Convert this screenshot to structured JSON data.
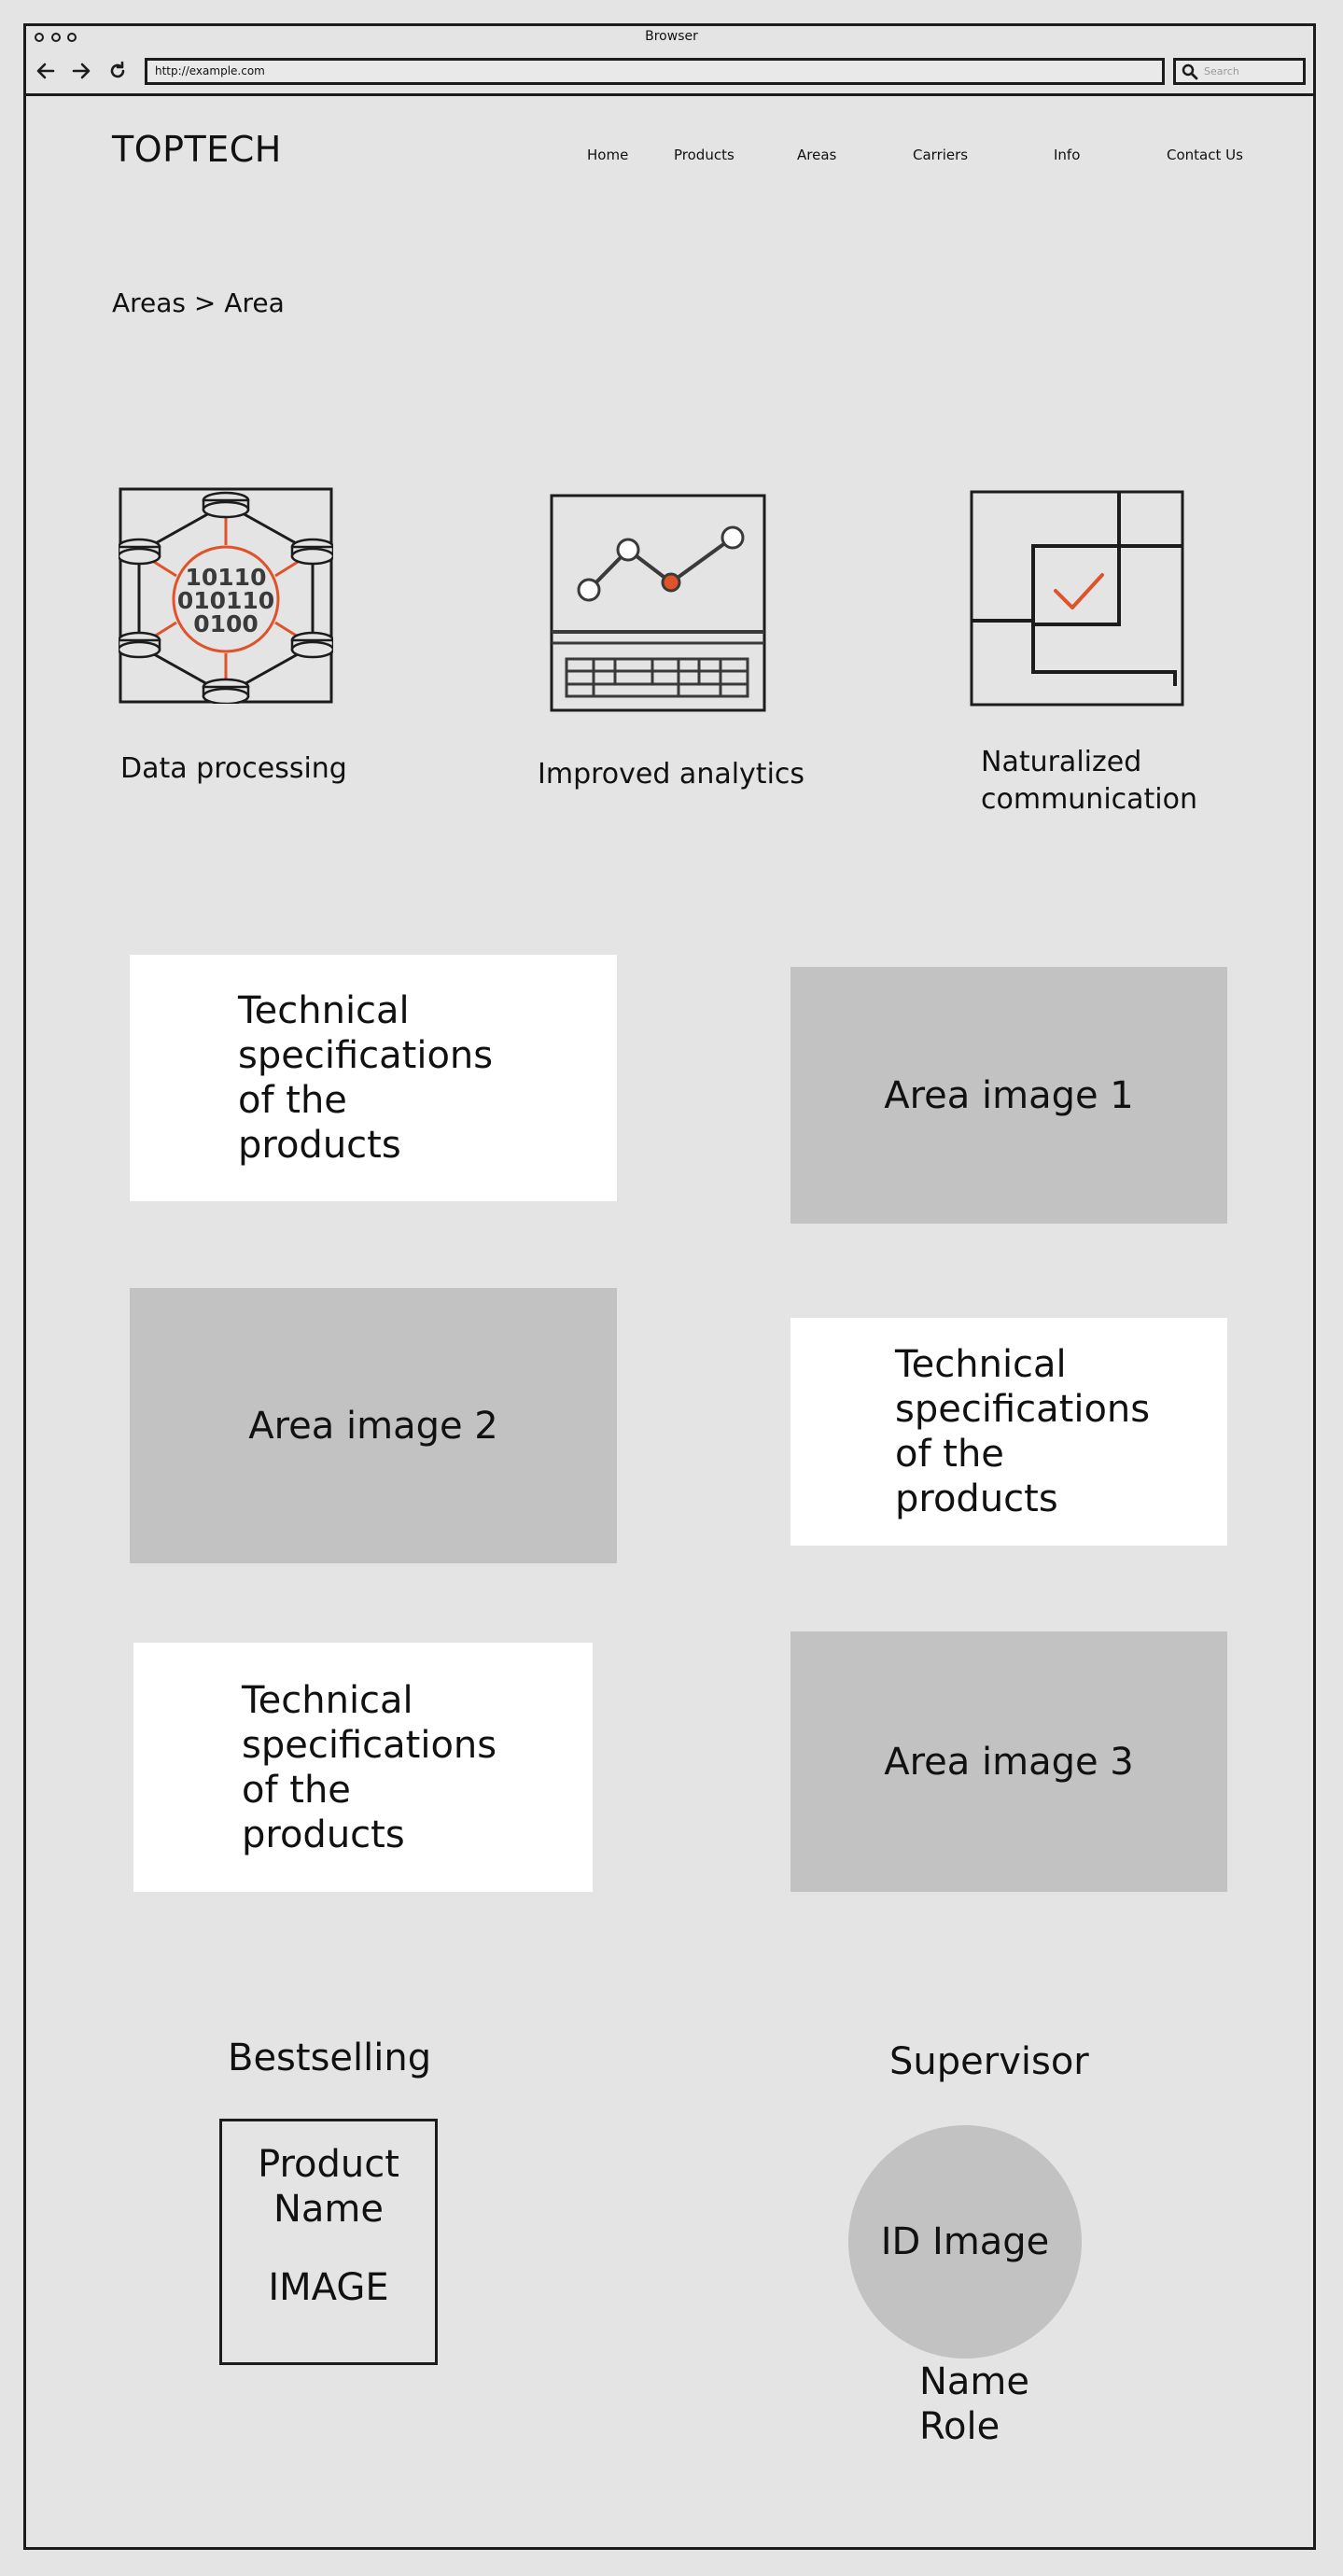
{
  "browser": {
    "title": "Browser",
    "url": "http://example.com",
    "search_placeholder": "Search"
  },
  "header": {
    "logo": "TOPTECH",
    "nav": [
      "Home",
      "Products",
      "Areas",
      "Carriers",
      "Info",
      "Contact Us"
    ]
  },
  "breadcrumb": "Areas > Area",
  "features": [
    {
      "label": "Data processing",
      "icon": "data-processing-icon",
      "binary": [
        "10110",
        "010110",
        "0100"
      ]
    },
    {
      "label": "Improved analytics",
      "icon": "analytics-laptop-icon"
    },
    {
      "label": "Naturalized communication",
      "icon": "communication-maze-icon"
    }
  ],
  "cards": {
    "spec_text": "Technical specifications of the products",
    "area_image_1": "Area image 1",
    "area_image_2": "Area image 2",
    "area_image_3": "Area image 3"
  },
  "bestselling": {
    "title": "Bestselling",
    "product_name": "Product Name",
    "image_label": "IMAGE"
  },
  "supervisor": {
    "title": "Supervisor",
    "image_label": "ID Image",
    "name": "Name",
    "role": "Role"
  },
  "colors": {
    "background": "#e4e4e4",
    "placeholder_gray": "#c2c2c2",
    "accent_orange": "#e0522a",
    "stroke": "#1c1c1c"
  }
}
